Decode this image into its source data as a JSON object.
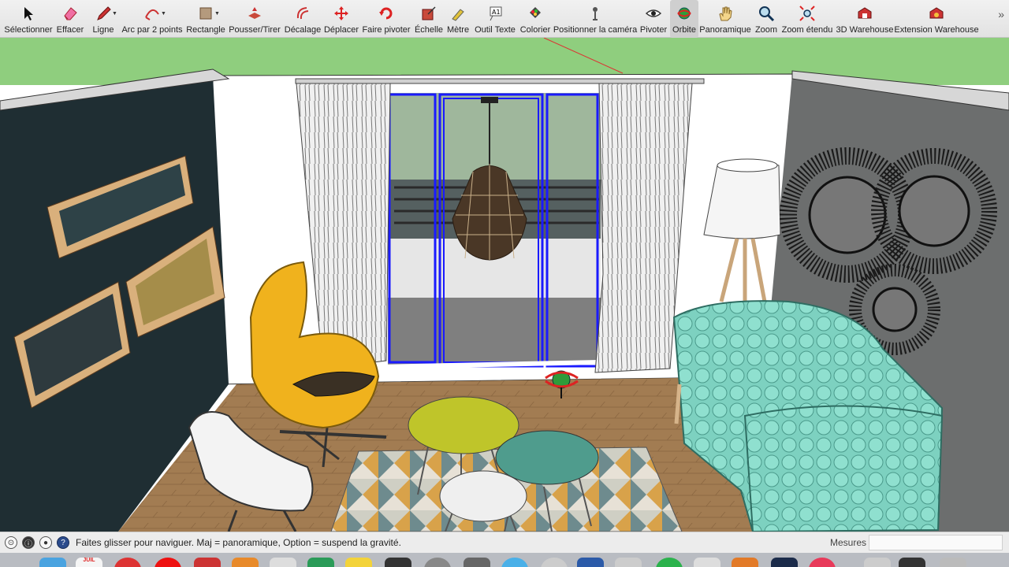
{
  "toolbar": {
    "tools": [
      {
        "label": "Sélectionner",
        "icon": "select-arrow-icon"
      },
      {
        "label": "Effacer",
        "icon": "eraser-icon"
      },
      {
        "label": "Ligne",
        "icon": "pencil-icon"
      },
      {
        "label": "Arc par 2 points",
        "icon": "arc-icon"
      },
      {
        "label": "Rectangle",
        "icon": "rectangle-icon"
      },
      {
        "label": "Pousser/Tirer",
        "icon": "push-pull-icon"
      },
      {
        "label": "Décalage",
        "icon": "offset-icon"
      },
      {
        "label": "Déplacer",
        "icon": "move-icon"
      },
      {
        "label": "Faire pivoter",
        "icon": "rotate-icon"
      },
      {
        "label": "Échelle",
        "icon": "scale-icon"
      },
      {
        "label": "Mètre",
        "icon": "tape-measure-icon"
      },
      {
        "label": "Outil Texte",
        "icon": "text-tool-icon"
      },
      {
        "label": "Colorier",
        "icon": "paint-bucket-icon"
      },
      {
        "label": "Positionner la caméra",
        "icon": "position-camera-icon"
      },
      {
        "label": "Pivoter",
        "icon": "eye-icon"
      },
      {
        "label": "Orbite",
        "icon": "orbit-icon"
      },
      {
        "label": "Panoramique",
        "icon": "hand-pan-icon"
      },
      {
        "label": "Zoom",
        "icon": "magnifier-icon"
      },
      {
        "label": "Zoom étendu",
        "icon": "zoom-extents-icon"
      },
      {
        "label": "3D Warehouse",
        "icon": "warehouse-icon"
      },
      {
        "label": "Extension Warehouse",
        "icon": "extension-warehouse-icon"
      }
    ],
    "active_tool": "Orbite",
    "more_icon": "chevron-double-right-icon"
  },
  "status": {
    "hint": "Faites glisser pour naviguer. Maj = panoramique, Option =  suspend la gravité.",
    "measure_label": "Mesures",
    "measure_value": ""
  },
  "dock": {
    "calendar_month": "JUIL"
  },
  "colors": {
    "sky": "#8fce7e",
    "accent_selection": "#1a1aff",
    "chair_yellow": "#f0b21d",
    "sofa_teal": "#7dd1c0",
    "wall_dark": "#1f2e33",
    "wall_grey": "#6c6e6e"
  }
}
